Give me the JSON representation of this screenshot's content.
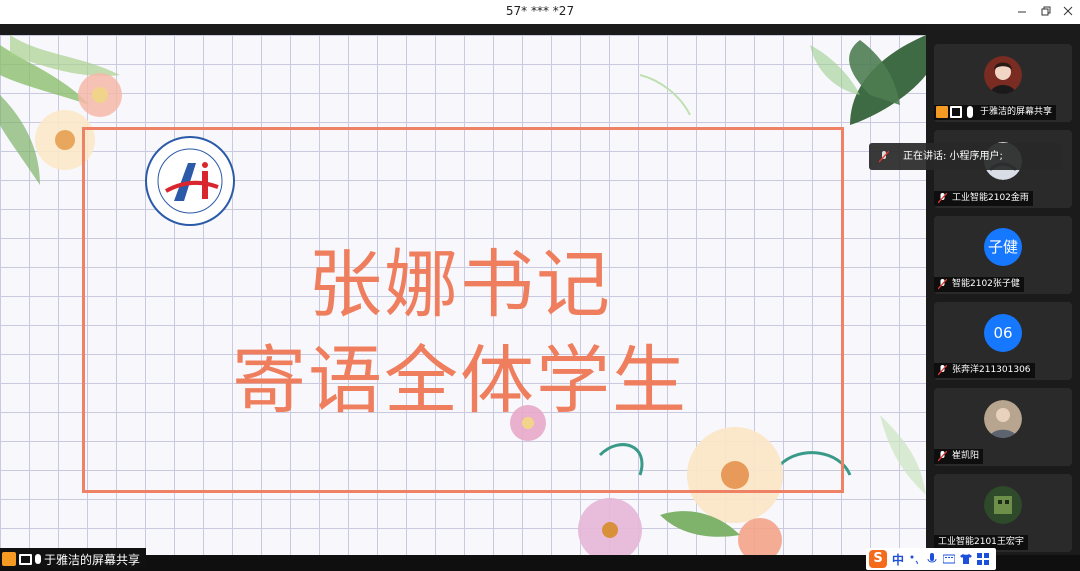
{
  "window": {
    "title": "57* *** *27"
  },
  "slide": {
    "line1": "张娜书记",
    "line2": "寄语全体学生",
    "colors": {
      "title": "#ef7e5e",
      "frame": "#ef8164",
      "grid": "#c9c9df"
    }
  },
  "share_label": "于雅洁的屏幕共享",
  "speaking": "正在讲话: 小程序用户;",
  "participants": [
    {
      "name": "于雅洁的屏幕共享",
      "avatar": "photo",
      "host": true
    },
    {
      "name": "工业智能2102金雨",
      "avatar": "photo"
    },
    {
      "name": "智能2102张子健",
      "avatar": "text",
      "avatar_text": "子健"
    },
    {
      "name": "张奔洋211301306",
      "avatar": "text",
      "avatar_text": "06"
    },
    {
      "name": "崔凯阳",
      "avatar": "photo"
    },
    {
      "name": "工业智能2101王宏宇",
      "avatar": "photo"
    }
  ],
  "tray": {
    "ime_label": "中"
  },
  "colors": {
    "accent_blue": "#1677ff",
    "host_orange": "#f59a23"
  }
}
